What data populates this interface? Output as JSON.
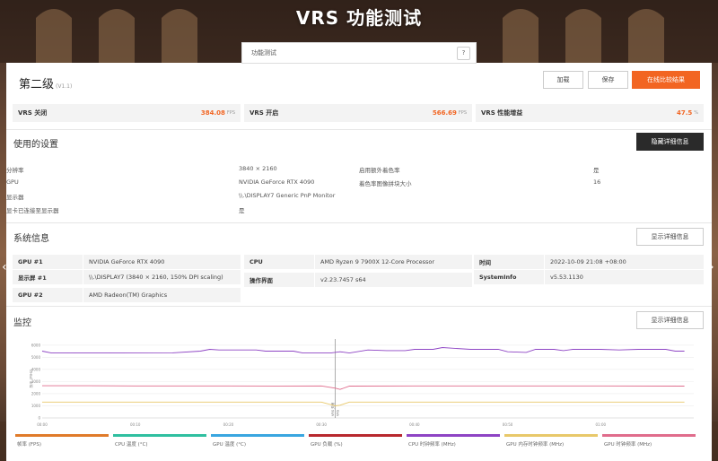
{
  "page": {
    "hero_title": "VRS 功能测试",
    "test_selector_label": "功能测试",
    "help_label": "?"
  },
  "header": {
    "level": "第二级",
    "version": "(V1.1)",
    "load_label": "加载",
    "save_label": "保存",
    "compare_label": "在线比较结果"
  },
  "scores": [
    {
      "label": "VRS 关闭",
      "value": "384.08",
      "unit": "FPS"
    },
    {
      "label": "VRS 开启",
      "value": "566.69",
      "unit": "FPS"
    },
    {
      "label": "VRS 性能增益",
      "value": "47.5",
      "unit": "%"
    }
  ],
  "settings": {
    "title": "使用的设置",
    "hide_details_label": "隐藏详细信息",
    "items": [
      {
        "key": "分辨率",
        "value": "3840 × 2160"
      },
      {
        "key": "GPU",
        "value": "NVIDIA GeForce RTX 4090"
      },
      {
        "key": "显示器",
        "value": "\\\\.\\DISPLAY7 Generic PnP Monitor"
      },
      {
        "key": "显卡已连接至显示器",
        "value": "是"
      },
      {
        "key": "启用额外着色率",
        "value": "是"
      },
      {
        "key": "着色率图像拼块大小",
        "value": "16"
      }
    ]
  },
  "sysinfo": {
    "title": "系统信息",
    "show_details_label": "显示详细信息",
    "col1": [
      {
        "key": "GPU #1",
        "value": "NVIDIA GeForce RTX 4090"
      },
      {
        "key": "显示屏 #1",
        "value": "\\\\.\\DISPLAY7 (3840 × 2160, 150% DPI scaling)"
      },
      {
        "key": "GPU #2",
        "value": "AMD Radeon(TM) Graphics"
      }
    ],
    "col2": [
      {
        "key": "CPU",
        "value": "AMD Ryzen 9 7900X 12-Core Processor"
      },
      {
        "key": "操作界面",
        "value": "v2.23.7457 s64"
      }
    ],
    "col3": [
      {
        "key": "时间",
        "value": "2022-10-09 21:08 +08:00"
      },
      {
        "key": "SystemInfo",
        "value": "v5.53.1130"
      }
    ]
  },
  "monitor": {
    "title": "监控",
    "show_details_label": "显示详细信息"
  },
  "chart_data": {
    "type": "line",
    "ylabel": "频率 (MHz)",
    "ylim": [
      0,
      6500
    ],
    "yticks": [
      0,
      1000,
      2000,
      3000,
      4000,
      5000,
      6000
    ],
    "xlim": [
      0,
      70
    ],
    "xticks": [
      "00:00",
      "00:10",
      "00:20",
      "00:30",
      "00:40",
      "00:50",
      "01:00"
    ],
    "marker_x": 31.5,
    "marker_label_1": "VRS 关闭",
    "marker_label_2": "VRS",
    "series": [
      {
        "name": "CPU 时钟频率 (MHz)",
        "color": "#8e44c4",
        "x": [
          0,
          1,
          3,
          8,
          14,
          17,
          18,
          19,
          23,
          24,
          27,
          28,
          31,
          32,
          33,
          35,
          37,
          39,
          40,
          42,
          43,
          44,
          46,
          49,
          50,
          52,
          53,
          55,
          56,
          57,
          60,
          62,
          64,
          66,
          67,
          68,
          69
        ],
        "y": [
          5500,
          5350,
          5360,
          5350,
          5360,
          5500,
          5650,
          5600,
          5600,
          5500,
          5500,
          5350,
          5350,
          5450,
          5350,
          5600,
          5550,
          5550,
          5650,
          5650,
          5800,
          5750,
          5650,
          5650,
          5450,
          5400,
          5650,
          5650,
          5550,
          5650,
          5650,
          5600,
          5650,
          5650,
          5650,
          5500,
          5500
        ]
      },
      {
        "name": "GPU 时钟频率 (MHz)",
        "color": "#e06c8c",
        "x": [
          0,
          5,
          10,
          15,
          20,
          25,
          30,
          31.5,
          32,
          33,
          40,
          50,
          60,
          69
        ],
        "y": [
          2650,
          2650,
          2640,
          2640,
          2640,
          2630,
          2640,
          2450,
          2350,
          2620,
          2640,
          2640,
          2640,
          2620
        ]
      },
      {
        "name": "GPU 内存时钟频率 (MHz)",
        "color": "#e8c86a",
        "x": [
          0,
          10,
          20,
          30,
          31.5,
          32,
          33,
          40,
          50,
          60,
          69
        ],
        "y": [
          1310,
          1310,
          1310,
          1310,
          1000,
          1050,
          1310,
          1310,
          1310,
          1310,
          1310
        ]
      }
    ],
    "legend": [
      {
        "label": "帧率 (FPS)",
        "color": "#e07b2a"
      },
      {
        "label": "CPU 温度 (°C)",
        "color": "#2fbfa0"
      },
      {
        "label": "GPU 温度 (°C)",
        "color": "#39a6e0"
      },
      {
        "label": "GPU 负载 (%)",
        "color": "#b8282e"
      },
      {
        "label": "CPU 时钟频率 (MHz)",
        "color": "#8e44c4"
      },
      {
        "label": "GPU 内存时钟频率 (MHz)",
        "color": "#e8c86a"
      },
      {
        "label": "GPU 时钟频率 (MHz)",
        "color": "#e06c8c"
      }
    ]
  },
  "colors": {
    "accent": "#f26522",
    "dark_button": "#2a2a2a"
  }
}
